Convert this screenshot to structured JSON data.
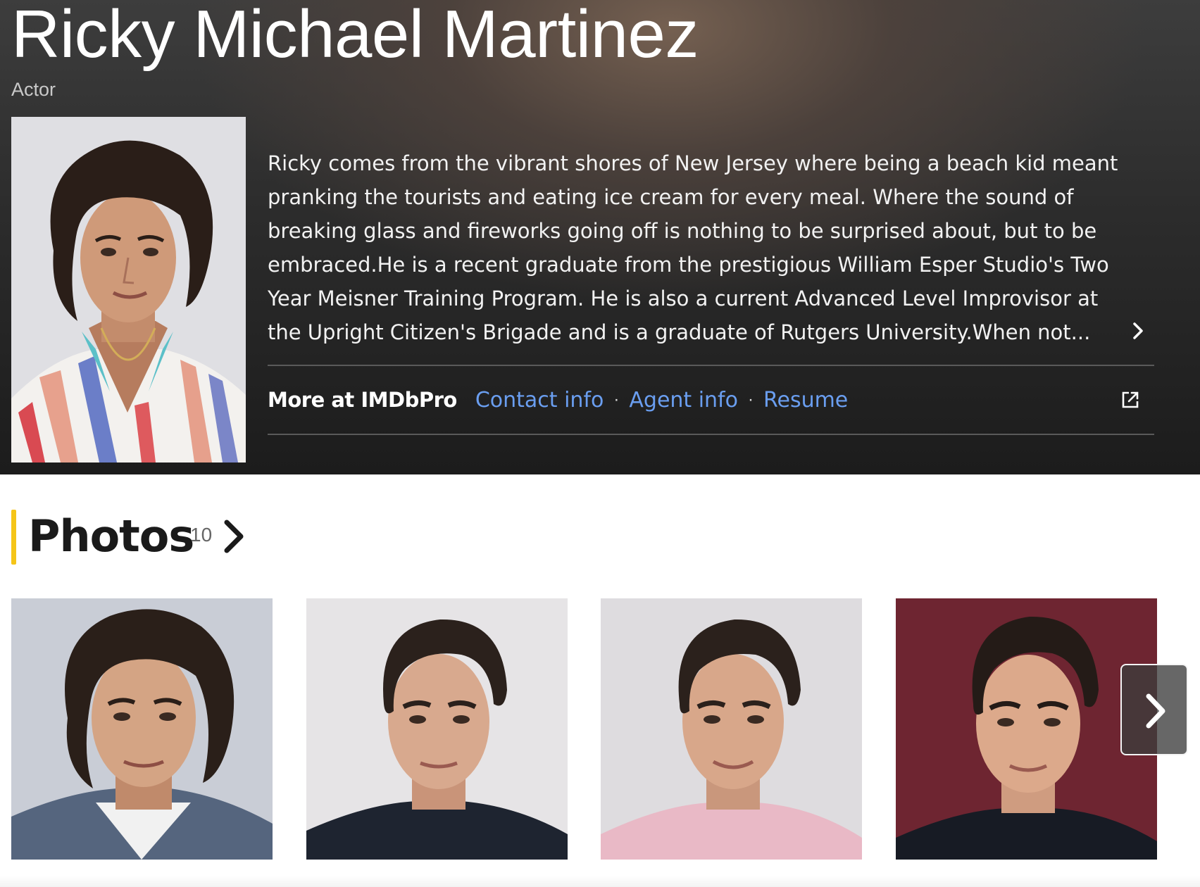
{
  "header": {
    "name": "Ricky Michael Martinez",
    "role": "Actor"
  },
  "bio": {
    "text": "Ricky comes from the vibrant shores of New Jersey where being a beach kid meant pranking the tourists and eating ice cream for every meal. Where the sound of breaking glass and fireworks going off is nothing to be surprised about, but to be embraced.He is a recent graduate from the prestigious William Esper Studio's Two Year Meisner Training Program. He is also a current Advanced Level Improvisor at the Upright Citizen's Brigade and is a graduate of Rutgers University.When not..."
  },
  "pro": {
    "label": "More at IMDbPro",
    "links": [
      "Contact info",
      "Agent info",
      "Resume"
    ]
  },
  "photos": {
    "title": "Photos",
    "count": "10",
    "items": [
      {
        "background": "#c9cdd6",
        "hair": "curly",
        "shirt": "#55657e",
        "skin": "#d4a484"
      },
      {
        "background": "#e6e4e6",
        "hair": "short",
        "shirt": "#1e2430",
        "skin": "#d8a98e"
      },
      {
        "background": "#dedcdf",
        "hair": "short",
        "shirt": "#e9b9c6",
        "skin": "#d8a78a"
      },
      {
        "background": "#6e2531",
        "hair": "short",
        "shirt": "#171b24",
        "skin": "#dca98b"
      }
    ]
  },
  "colors": {
    "accent": "#f5c518",
    "link": "#6a9ef0"
  }
}
